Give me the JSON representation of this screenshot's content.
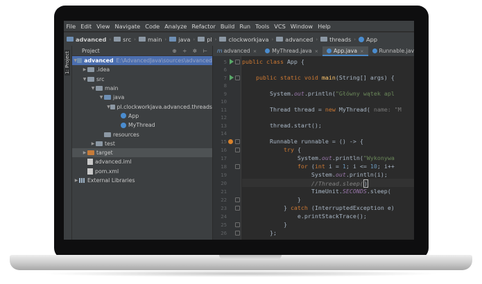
{
  "menu": [
    "File",
    "Edit",
    "View",
    "Navigate",
    "Code",
    "Analyze",
    "Refactor",
    "Build",
    "Run",
    "Tools",
    "VCS",
    "Window",
    "Help"
  ],
  "breadcrumbs": [
    {
      "label": "advanced",
      "bold": true
    },
    {
      "label": "src"
    },
    {
      "label": "main"
    },
    {
      "label": "java"
    },
    {
      "label": "pl"
    },
    {
      "label": "clockworkjava"
    },
    {
      "label": "advanced"
    },
    {
      "label": "threads"
    },
    {
      "label": "App",
      "type": "class"
    }
  ],
  "side_strip_label": "1: Project",
  "project_panel": {
    "title": "Project",
    "icons": "⊕ ÷ ✲ ⊢"
  },
  "tree": [
    {
      "label": "advanced",
      "path": "E:\\AdvancedJava\\sources\\advanced",
      "indent": 0,
      "arrow": "▼",
      "icon": "folder-blue",
      "selected": true,
      "bold": true
    },
    {
      "label": ".idea",
      "indent": 1,
      "arrow": "▶",
      "icon": "folder"
    },
    {
      "label": "src",
      "indent": 1,
      "arrow": "▼",
      "icon": "folder"
    },
    {
      "label": "main",
      "indent": 2,
      "arrow": "▼",
      "icon": "folder"
    },
    {
      "label": "java",
      "indent": 3,
      "arrow": "▼",
      "icon": "folder-blue"
    },
    {
      "label": "pl.clockworkjava.advanced.threads",
      "indent": 4,
      "arrow": "▼",
      "icon": "folder"
    },
    {
      "label": "App",
      "indent": 5,
      "arrow": "",
      "icon": "class"
    },
    {
      "label": "MyThread",
      "indent": 5,
      "arrow": "",
      "icon": "class"
    },
    {
      "label": "resources",
      "indent": 3,
      "arrow": "",
      "icon": "folder"
    },
    {
      "label": "test",
      "indent": 2,
      "arrow": "▶",
      "icon": "folder"
    },
    {
      "label": "target",
      "indent": 1,
      "arrow": "▶",
      "icon": "folder-orange",
      "highlight": true
    },
    {
      "label": "advanced.iml",
      "indent": 1,
      "arrow": "",
      "icon": "file"
    },
    {
      "label": "pom.xml",
      "indent": 1,
      "arrow": "",
      "icon": "file"
    },
    {
      "label": "External Libraries",
      "indent": 0,
      "arrow": "▶",
      "icon": "library"
    }
  ],
  "tabs": [
    {
      "label": "advanced",
      "marker": "m",
      "active": false
    },
    {
      "label": "MyThread.java",
      "marker": "",
      "active": false
    },
    {
      "label": "App.java",
      "marker": "",
      "active": true
    },
    {
      "label": "Runnable.java",
      "marker": "",
      "active": false
    }
  ],
  "line_numbers": [
    "5",
    "6",
    "7",
    "8",
    "9",
    "10",
    "11",
    "12",
    "13",
    "14",
    "15",
    "16",
    "17",
    "18",
    "19",
    "20",
    "21",
    "22",
    "23",
    "24",
    "25",
    "26"
  ],
  "code": {
    "l5_a": "public class ",
    "l5_b": "App {",
    "l6_a": "    public static void ",
    "l6_b": "main",
    "l6_c": "(String[] args) {",
    "l8_a": "        System.",
    "l8_b": "out",
    "l8_c": ".println(",
    "l8_d": "\"Główny wątek apl",
    "l10_a": "        Thread thread = ",
    "l10_b": "new ",
    "l10_c": "MyThread( ",
    "l10_d": "name: \"M",
    "l12": "        thread.start();",
    "l14_a": "        Runnable runnable = () -> {",
    "l15_a": "            ",
    "l15_b": "try ",
    "l15_c": "{",
    "l16_a": "                System.",
    "l16_b": "out",
    "l16_c": ".println(",
    "l16_d": "\"Wykonywa",
    "l17_a": "                ",
    "l17_b": "for ",
    "l17_c": "(",
    "l17_d": "int ",
    "l17_e": "i = ",
    "l17_f": "1",
    "l17_g": "; i <= ",
    "l17_h": "10",
    "l17_i": "; i++",
    "l18_a": "                    System.",
    "l18_b": "out",
    "l18_c": ".println(i);",
    "l19_a": "                    //Thread.sleep(",
    "l19_b": ")",
    "l20_a": "                    TimeUnit.",
    "l20_b": "SECONDS",
    "l20_c": ".sleep( ",
    "l21": "                }",
    "l22_a": "            } ",
    "l22_b": "catch ",
    "l22_c": "(InterruptedException e)",
    "l23": "                e.printStackTrace();",
    "l24": "            }",
    "l25": "        };"
  }
}
